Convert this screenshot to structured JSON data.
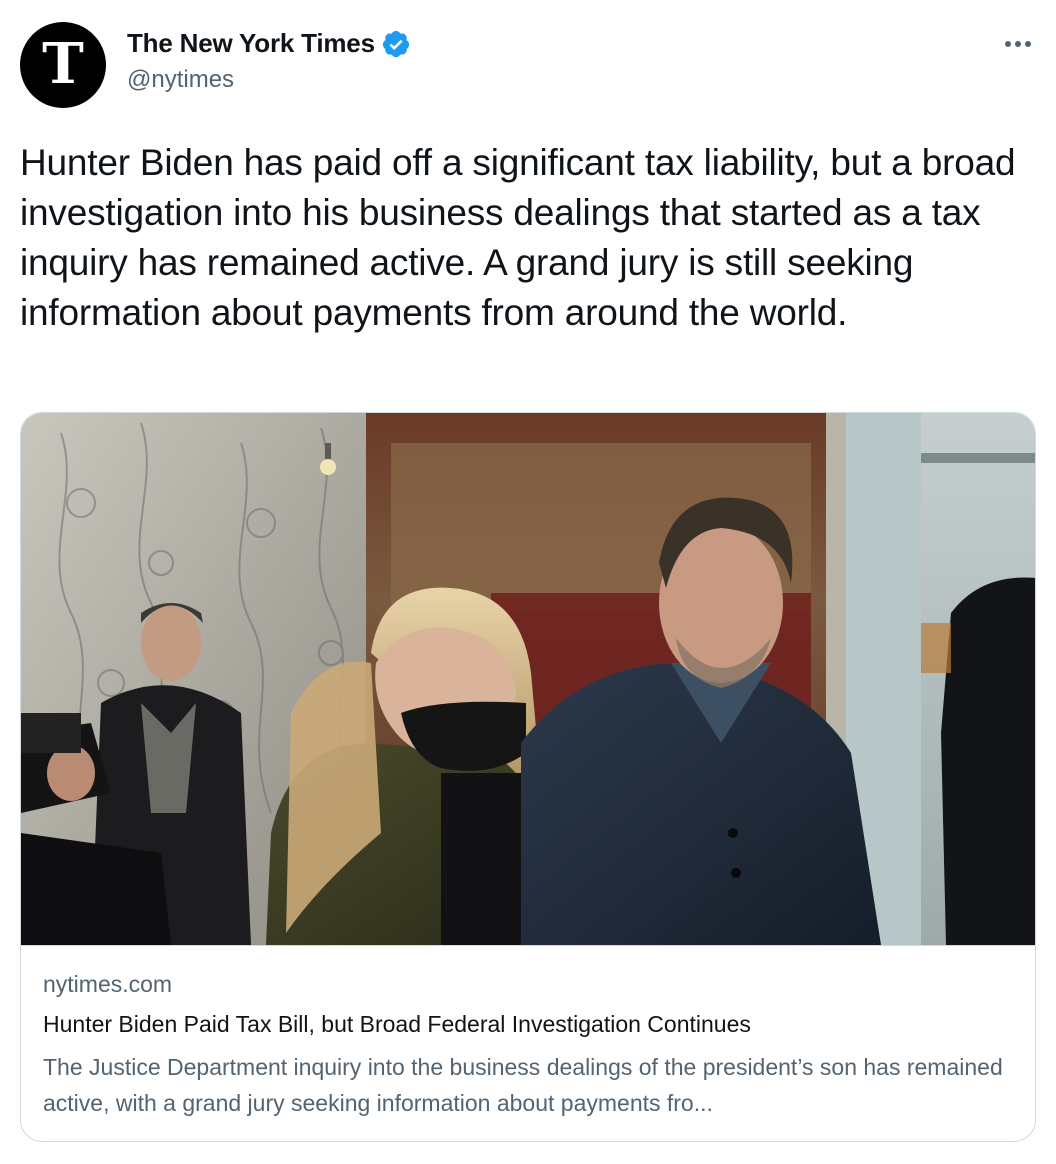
{
  "author": {
    "display_name": "The New York Times",
    "handle": "@nytimes",
    "avatar_letter": "T",
    "verified": true
  },
  "menu": {
    "icon": "more-icon"
  },
  "tweet": {
    "text": "Hunter Biden has paid off a significant tax liability, but a broad investigation into his business dealings that started as a tax inquiry has remained active. A grand jury is still seeking information about payments from around the world."
  },
  "link_card": {
    "domain": "nytimes.com",
    "title": "Hunter Biden Paid Tax Bill, but Broad Federal Investigation Continues",
    "description": "The Justice Department inquiry into the business dealings of the president’s son has remained active, with a grand jury seeking information about payments fro..."
  },
  "colors": {
    "verified_blue": "#1d9bf0",
    "text_primary": "#0f1419",
    "text_secondary": "#536471",
    "border": "#cfd9de"
  }
}
